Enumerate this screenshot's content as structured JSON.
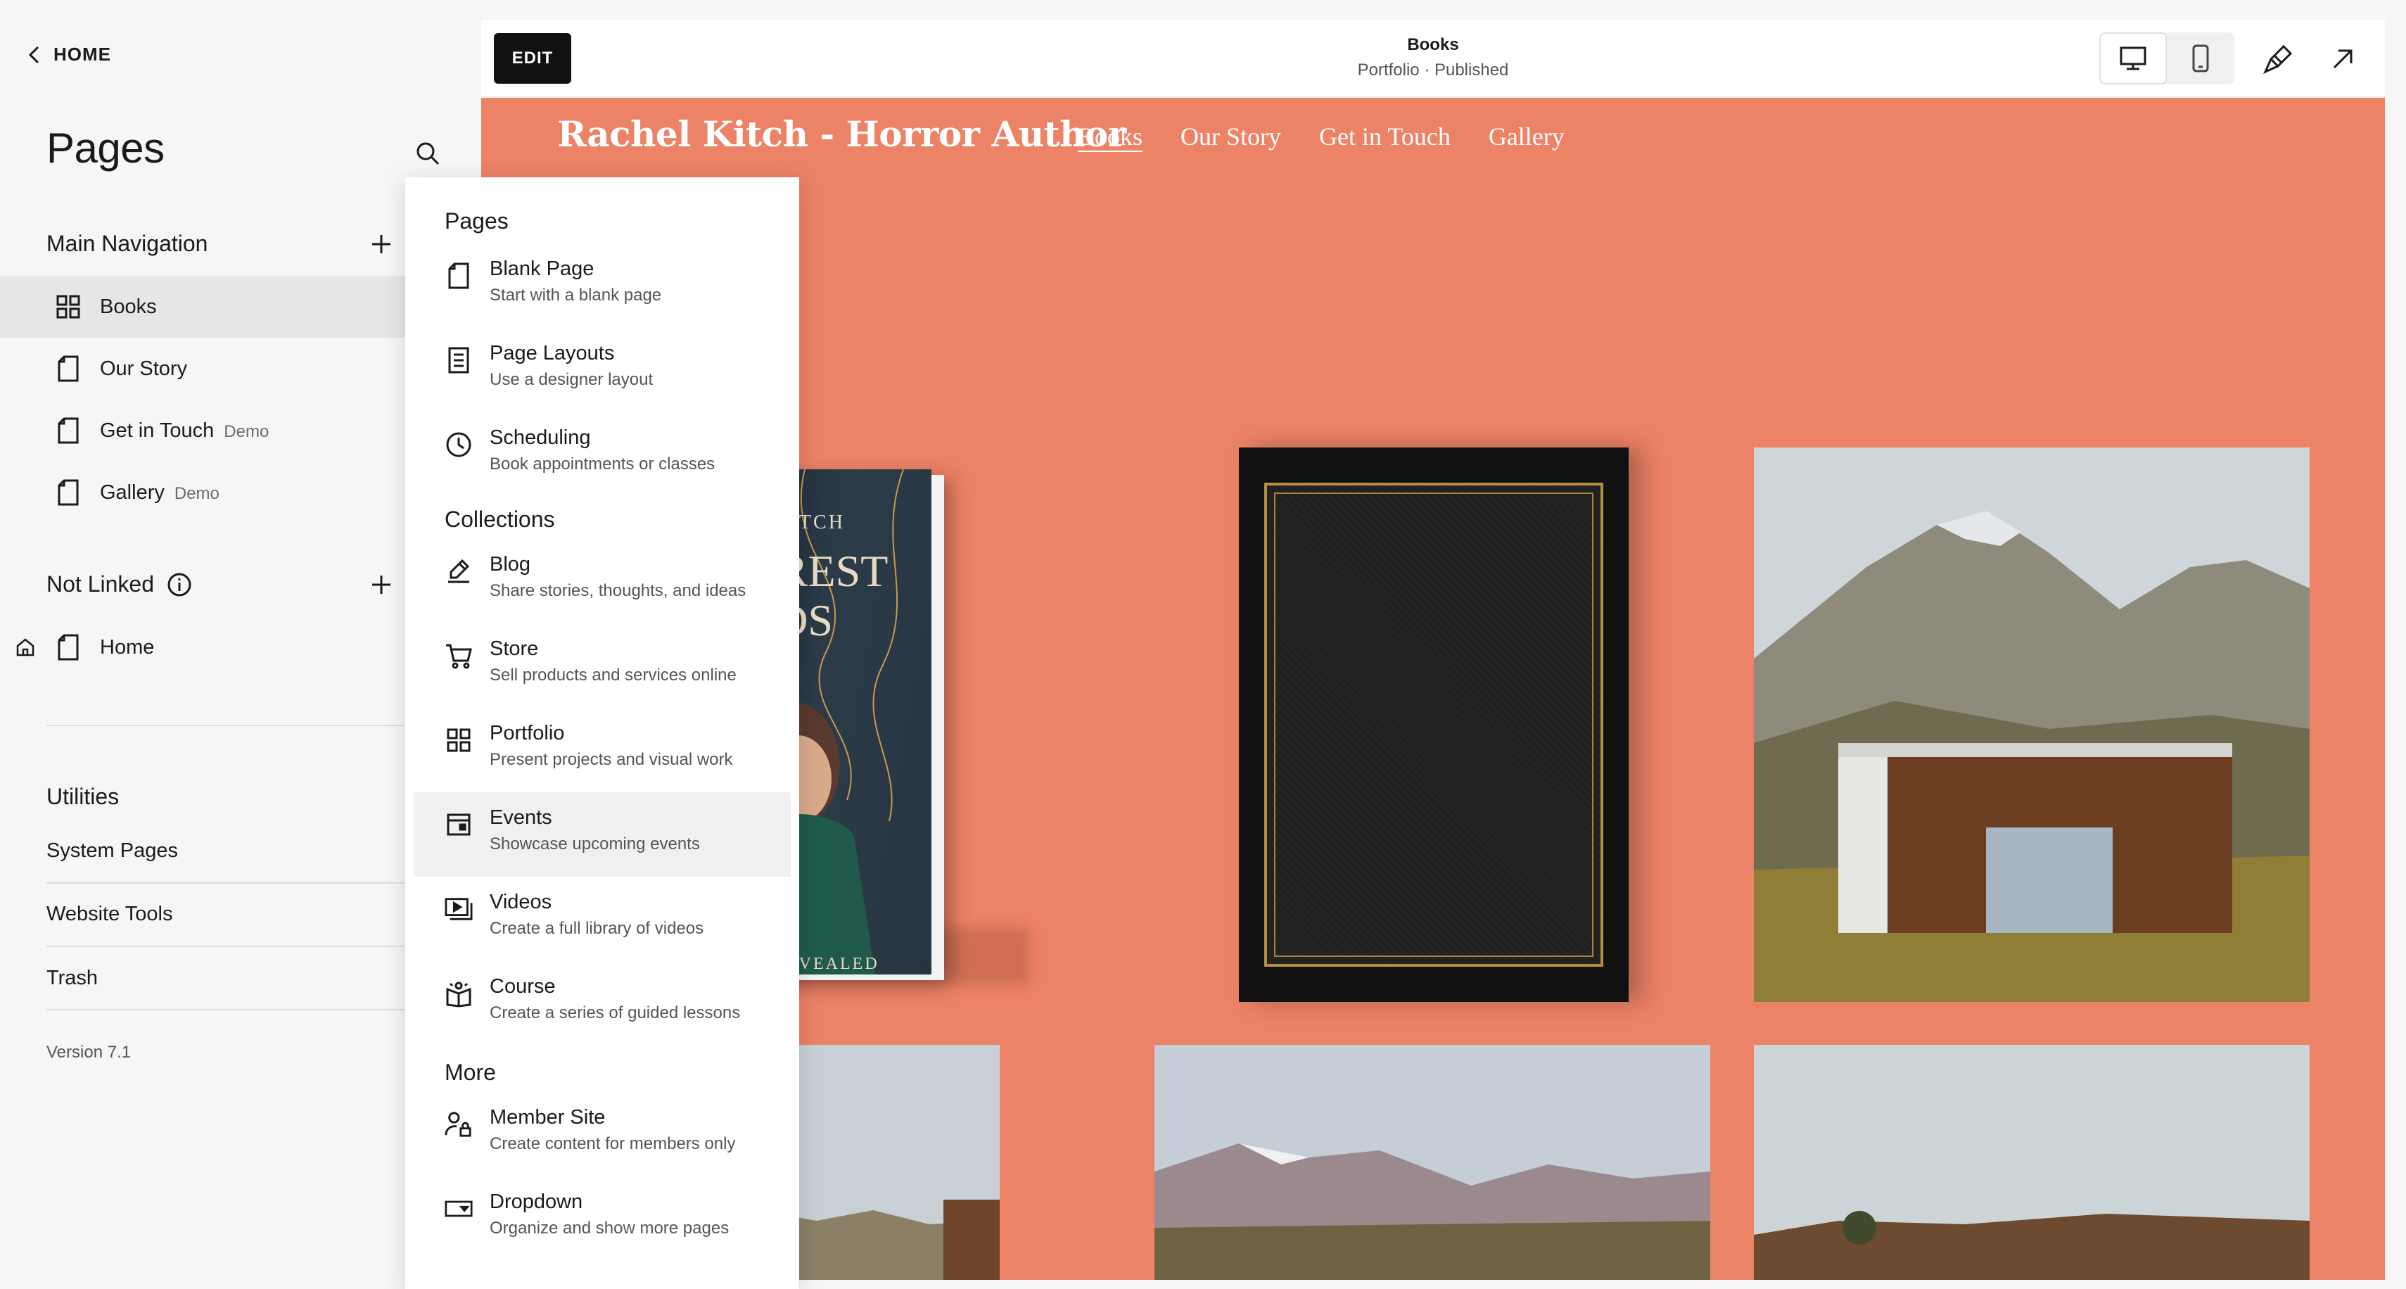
{
  "sidebar": {
    "home_label": "HOME",
    "title": "Pages",
    "main_nav": {
      "heading": "Main Navigation",
      "items": [
        {
          "label": "Books",
          "tag": "",
          "icon": "grid-icon",
          "selected": true
        },
        {
          "label": "Our Story",
          "tag": "",
          "icon": "page-icon"
        },
        {
          "label": "Get in Touch",
          "tag": "Demo",
          "icon": "page-icon"
        },
        {
          "label": "Gallery",
          "tag": "Demo",
          "icon": "page-icon"
        }
      ]
    },
    "not_linked": {
      "heading": "Not Linked",
      "items": [
        {
          "label": "Home",
          "icon": "page-icon",
          "badge": "homepage-icon"
        }
      ]
    },
    "utilities": {
      "heading": "Utilities",
      "items": [
        "System Pages",
        "Website Tools",
        "Trash"
      ]
    },
    "version": "Version 7.1"
  },
  "topbar": {
    "edit_label": "EDIT",
    "page_title": "Books",
    "page_subtitle": "Portfolio · Published"
  },
  "site": {
    "title": "Rachel Kitch - Horror Author",
    "nav": [
      "Books",
      "Our Story",
      "Get in Touch",
      "Gallery"
    ],
    "active_nav": "Books",
    "background_color": "#ec8266",
    "book_cover": {
      "author": "HEL KITCH",
      "title_line1": "FOREST",
      "title_line2": "EEDS",
      "footer": "D BE REVEALED"
    }
  },
  "menu": {
    "sections": [
      {
        "heading": "Pages",
        "items": [
          {
            "title": "Blank Page",
            "sub": "Start with a blank page",
            "icon": "blank-page-icon"
          },
          {
            "title": "Page Layouts",
            "sub": "Use a designer layout",
            "icon": "layout-icon"
          },
          {
            "title": "Scheduling",
            "sub": "Book appointments or classes",
            "icon": "clock-icon"
          }
        ]
      },
      {
        "heading": "Collections",
        "items": [
          {
            "title": "Blog",
            "sub": "Share stories, thoughts, and ideas",
            "icon": "blog-icon"
          },
          {
            "title": "Store",
            "sub": "Sell products and services online",
            "icon": "cart-icon"
          },
          {
            "title": "Portfolio",
            "sub": "Present projects and visual work",
            "icon": "grid-icon"
          },
          {
            "title": "Events",
            "sub": "Showcase upcoming events",
            "icon": "calendar-icon",
            "hover": true
          },
          {
            "title": "Videos",
            "sub": "Create a full library of videos",
            "icon": "video-icon"
          },
          {
            "title": "Course",
            "sub": "Create a series of guided lessons",
            "icon": "course-icon"
          }
        ]
      },
      {
        "heading": "More",
        "items": [
          {
            "title": "Member Site",
            "sub": "Create content for members only",
            "icon": "member-lock-icon"
          },
          {
            "title": "Dropdown",
            "sub": "Organize and show more pages",
            "icon": "dropdown-icon"
          }
        ]
      }
    ]
  }
}
